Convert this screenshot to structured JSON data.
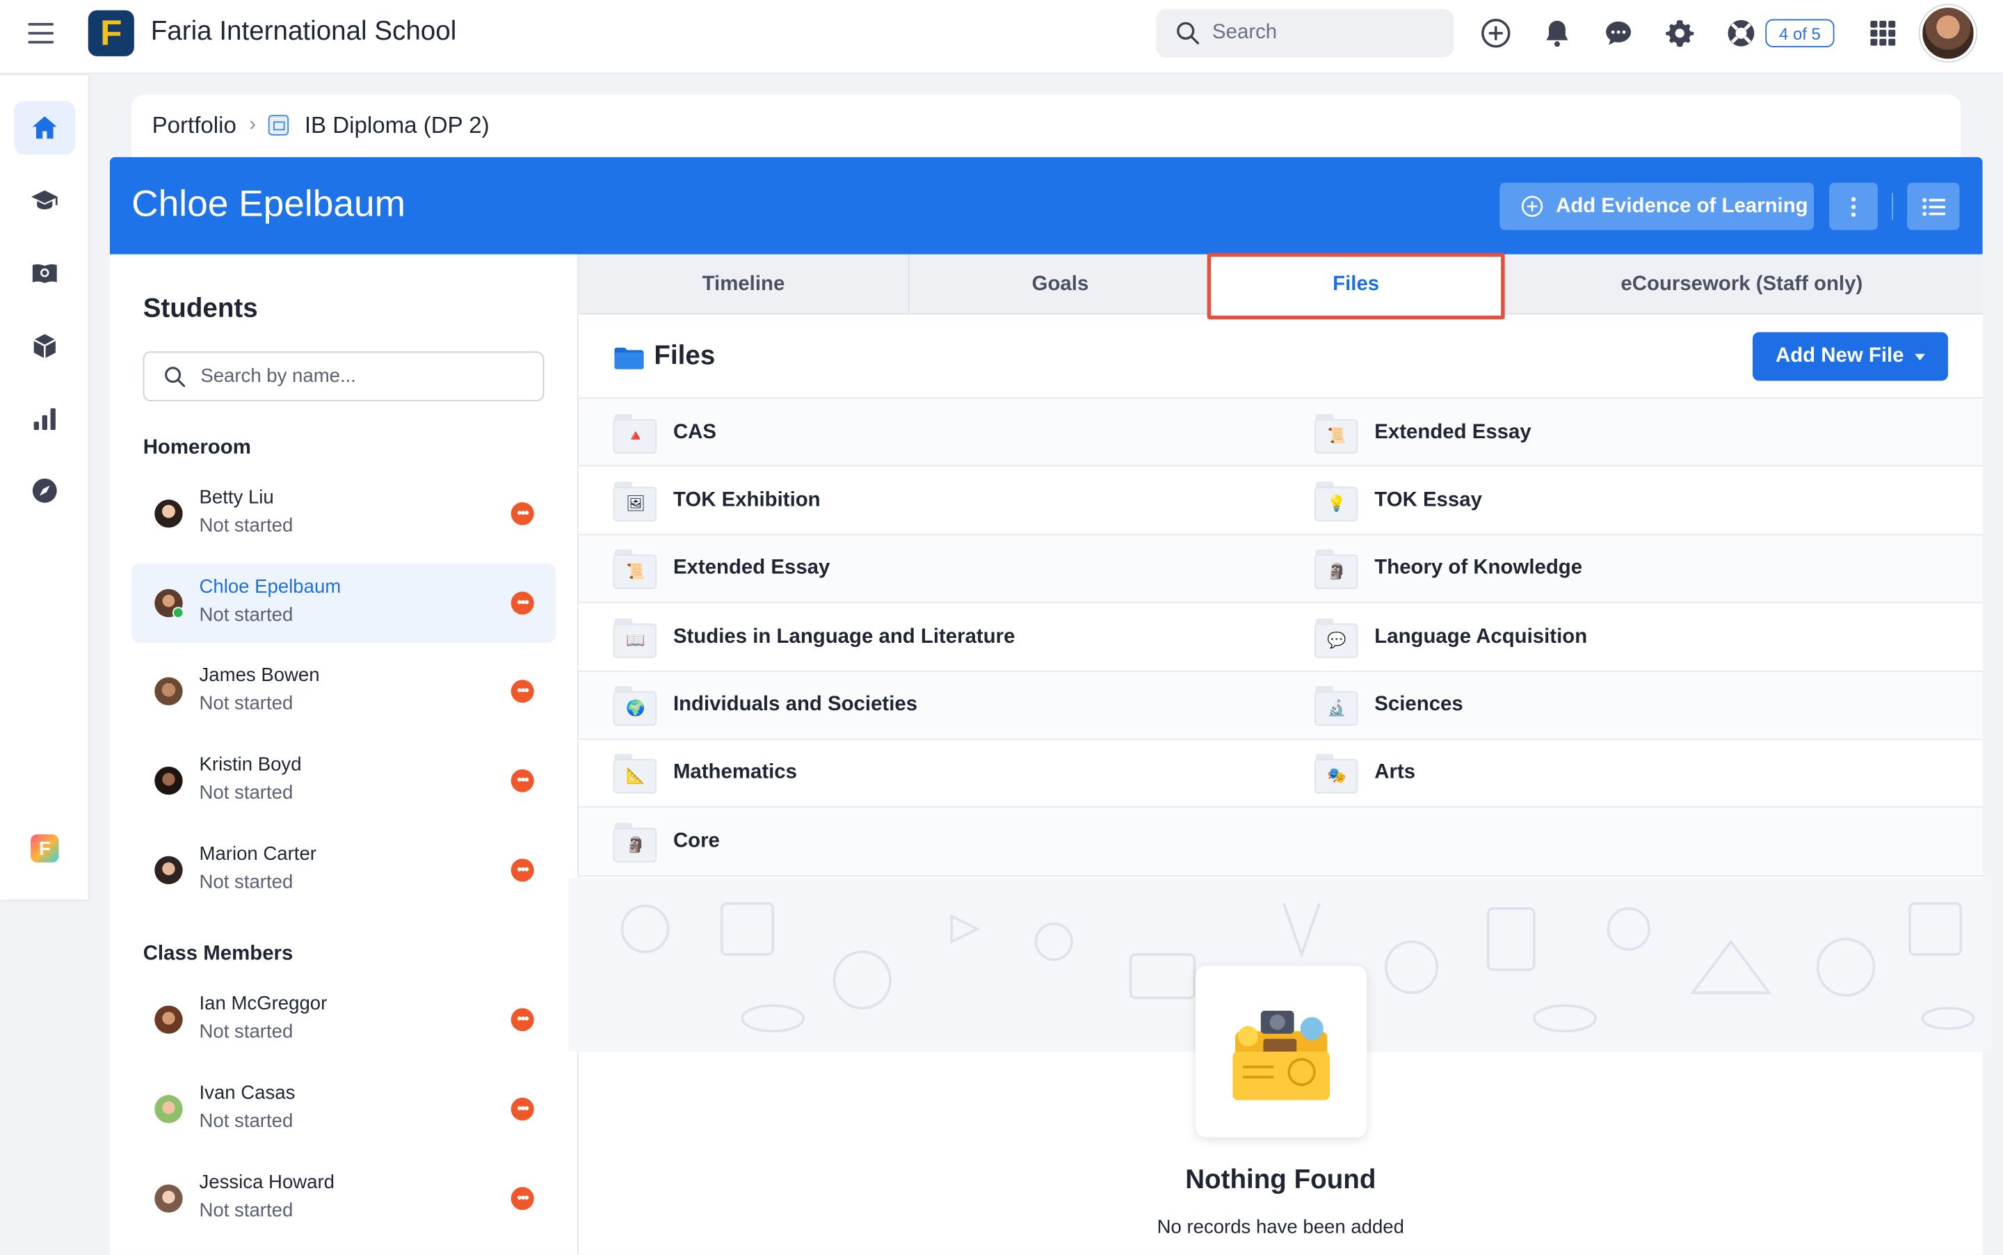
{
  "topbar": {
    "school_name": "Faria International School",
    "logo_letter": "F",
    "search_placeholder": "Search",
    "counter": "4 of 5"
  },
  "breadcrumb": {
    "root": "Portfolio",
    "current": "IB Diploma (DP 2)"
  },
  "header": {
    "student_name": "Chloe Epelbaum",
    "add_evidence_label": "Add Evidence of Learning"
  },
  "students_panel": {
    "title": "Students",
    "search_placeholder": "Search by name...",
    "homeroom_label": "Homeroom",
    "class_members_label": "Class Members",
    "homeroom": [
      {
        "name": "Betty Liu",
        "status": "Not started"
      },
      {
        "name": "Chloe Epelbaum",
        "status": "Not started"
      },
      {
        "name": "James Bowen",
        "status": "Not started"
      },
      {
        "name": "Kristin Boyd",
        "status": "Not started"
      },
      {
        "name": "Marion Carter",
        "status": "Not started"
      }
    ],
    "class_members": [
      {
        "name": "Ian McGreggor",
        "status": "Not started"
      },
      {
        "name": "Ivan Casas",
        "status": "Not started"
      },
      {
        "name": "Jessica Howard",
        "status": "Not started"
      }
    ]
  },
  "tabs": [
    {
      "label": "Timeline"
    },
    {
      "label": "Goals"
    },
    {
      "label": "Files"
    },
    {
      "label": "eCoursework (Staff only)"
    }
  ],
  "active_tab": "Files",
  "files": {
    "title": "Files",
    "add_button": "Add New File",
    "folders": [
      [
        "CAS",
        "Extended Essay"
      ],
      [
        "TOK Exhibition",
        "TOK Essay"
      ],
      [
        "Extended Essay",
        "Theory of Knowledge"
      ],
      [
        "Studies in Language and Literature",
        "Language Acquisition"
      ],
      [
        "Individuals and Societies",
        "Sciences"
      ],
      [
        "Mathematics",
        "Arts"
      ],
      [
        "Core",
        ""
      ]
    ]
  },
  "empty_state": {
    "title": "Nothing Found",
    "subtitle": "No records have been added"
  },
  "colors": {
    "brand_blue": "#1e73e8",
    "highlight_red": "#e5513f",
    "status_orange": "#f0582a"
  }
}
